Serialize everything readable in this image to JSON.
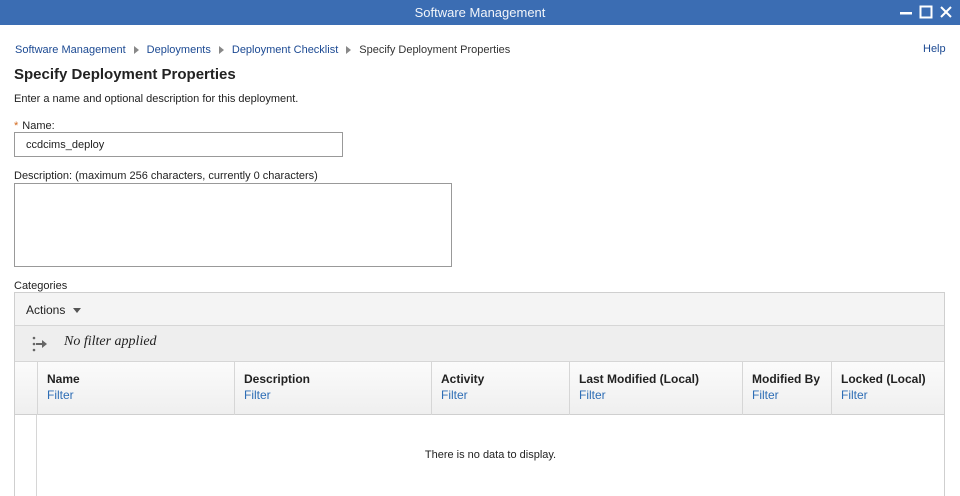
{
  "window": {
    "title": "Software Management",
    "controls": [
      "minimize-icon",
      "maximize-icon",
      "close-icon"
    ]
  },
  "breadcrumb": {
    "items": [
      "Software Management",
      "Deployments",
      "Deployment Checklist"
    ],
    "current": "Specify Deployment Properties"
  },
  "help_label": "Help",
  "page": {
    "title": "Specify Deployment Properties",
    "intro": "Enter a name and optional description for this deployment."
  },
  "form": {
    "required_mark": "*",
    "name_label": "Name:",
    "name_value": "ccdcims_deploy",
    "description_label": "Description: (maximum 256 characters, currently 0 characters)",
    "description_value": ""
  },
  "categories": {
    "label": "Categories",
    "actions_label": "Actions",
    "filter_status": "No filter applied",
    "columns": [
      {
        "name": "Name",
        "filter": "Filter"
      },
      {
        "name": "Description",
        "filter": "Filter"
      },
      {
        "name": "Activity",
        "filter": "Filter"
      },
      {
        "name": "Last Modified (Local)",
        "filter": "Filter"
      },
      {
        "name": "Modified By",
        "filter": "Filter"
      },
      {
        "name": "Locked (Local)",
        "filter": "Filter"
      }
    ],
    "empty_message": "There is no data to display."
  },
  "colors": {
    "titlebar": "#3b6db3",
    "link": "#1c4a93",
    "filter_link": "#2d6db5",
    "required": "#d2691e"
  }
}
